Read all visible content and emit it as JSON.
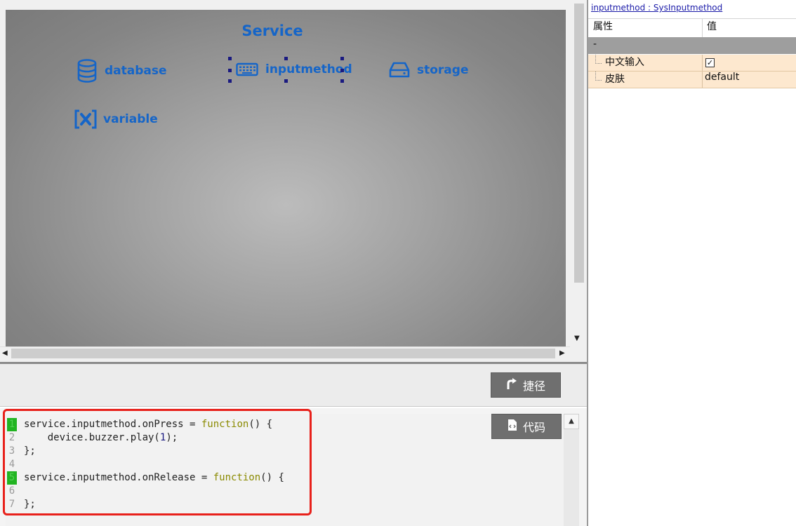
{
  "canvas": {
    "title": "Service",
    "services": [
      {
        "name": "database",
        "icon": "database-icon"
      },
      {
        "name": "inputmethod",
        "icon": "keyboard-icon"
      },
      {
        "name": "storage",
        "icon": "hard-drive-icon"
      },
      {
        "name": "variable",
        "icon": "variable-icon"
      }
    ],
    "accent_color": "#1565c8",
    "selection_handle_color": "#1a1a80"
  },
  "toolbar": {
    "shortcut_label": "捷径",
    "shortcut_icon": "shortcut-arrow-icon",
    "code_label": "代码",
    "code_icon": "code-file-icon"
  },
  "editor": {
    "lines": [
      {
        "num": "1",
        "marked": true,
        "segments": [
          {
            "t": "service.inputmethod.onPress = ",
            "c": "plain"
          },
          {
            "t": "function",
            "c": "kw"
          },
          {
            "t": "() {",
            "c": "plain"
          }
        ]
      },
      {
        "num": "2",
        "marked": false,
        "segments": [
          {
            "t": "    device.buzzer.play(",
            "c": "plain"
          },
          {
            "t": "1",
            "c": "num"
          },
          {
            "t": ");",
            "c": "plain"
          }
        ]
      },
      {
        "num": "3",
        "marked": false,
        "segments": [
          {
            "t": "};",
            "c": "plain"
          }
        ]
      },
      {
        "num": "4",
        "marked": false,
        "segments": []
      },
      {
        "num": "5",
        "marked": true,
        "segments": [
          {
            "t": "service.inputmethod.onRelease = ",
            "c": "plain"
          },
          {
            "t": "function",
            "c": "kw"
          },
          {
            "t": "() {",
            "c": "plain"
          }
        ]
      },
      {
        "num": "6",
        "marked": false,
        "segments": []
      },
      {
        "num": "7",
        "marked": false,
        "segments": [
          {
            "t": "};",
            "c": "plain"
          }
        ]
      }
    ],
    "highlight_color": "#e8211b"
  },
  "properties": {
    "object_link": "inputmethod : SysInputmethod",
    "header_property": "属性",
    "header_value": "值",
    "group_label": "-",
    "rows": [
      {
        "name": "中文输入",
        "type": "checkbox",
        "checked": true
      },
      {
        "name": "皮肤",
        "type": "text",
        "value": "default"
      }
    ]
  }
}
